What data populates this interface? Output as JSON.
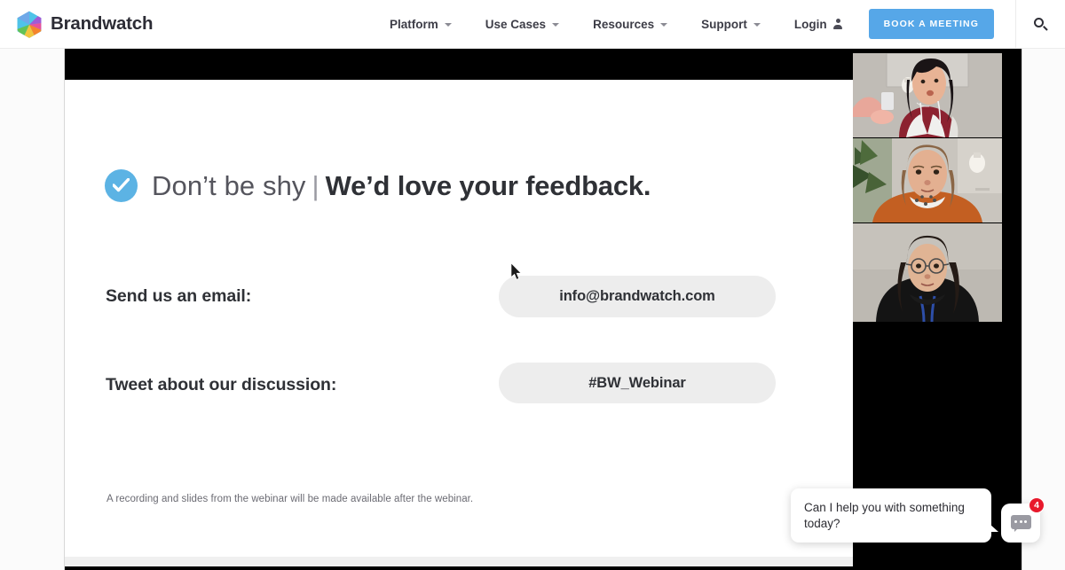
{
  "header": {
    "brand_name": "Brandwatch",
    "brand_logo_icon": "brandwatch-hexagon-logo",
    "nav_items": [
      {
        "label": "Platform",
        "indicator": "chevron-down-icon"
      },
      {
        "label": "Use Cases",
        "indicator": "chevron-down-icon"
      },
      {
        "label": "Resources",
        "indicator": "chevron-down-icon"
      },
      {
        "label": "Support",
        "indicator": "chevron-down-icon"
      },
      {
        "label": "Login",
        "indicator": "person-icon"
      }
    ],
    "cta_label": "BOOK A MEETING",
    "cta_color": "#56a7e8",
    "search_icon": "search-icon"
  },
  "slide": {
    "check_icon": "check-circle-icon",
    "check_color": "#5cb3e4",
    "headline_light": "Don’t be shy",
    "headline_separator": "|",
    "headline_bold": "We’d love your feedback.",
    "rows": [
      {
        "label": "Send us an email:",
        "value": "info@brandwatch.com"
      },
      {
        "label": "Tweet about our discussion:",
        "value": "#BW_Webinar"
      }
    ],
    "note": "A recording and slides from the webinar will be made available after the webinar.",
    "pill_color": "#ededed"
  },
  "video_strip": {
    "participants": [
      {
        "name": "participant-1"
      },
      {
        "name": "participant-2"
      },
      {
        "name": "participant-3"
      }
    ]
  },
  "chat": {
    "message": "Can I help you with something today?",
    "launcher_icon": "chat-bubble-icon",
    "badge_count": "4",
    "badge_color": "#e8192c"
  },
  "cursor": {
    "icon": "mouse-pointer-icon"
  }
}
